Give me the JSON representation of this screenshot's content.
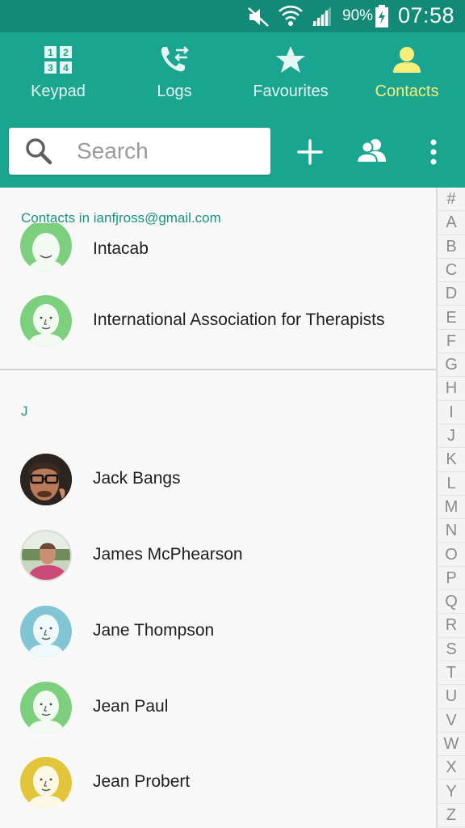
{
  "status_bar": {
    "battery_percent": "90%",
    "time": "07:58",
    "icons": [
      "mute-icon",
      "wifi-icon",
      "signal-icon",
      "battery-charging-icon"
    ]
  },
  "tabs": [
    {
      "label": "Keypad",
      "icon": "keypad-icon",
      "active": false
    },
    {
      "label": "Logs",
      "icon": "call-log-icon",
      "active": false
    },
    {
      "label": "Favourites",
      "icon": "star-icon",
      "active": false
    },
    {
      "label": "Contacts",
      "icon": "contact-person-icon",
      "active": true
    }
  ],
  "toolbar": {
    "search_placeholder": "Search",
    "actions": [
      "add-contact-icon",
      "groups-icon",
      "more-options-icon"
    ]
  },
  "contacts_list": {
    "account_header": "Contacts in ianfjross@gmail.com",
    "partial_contact": "Intacab",
    "contacts_before": [
      {
        "name": "International Association for Therapists",
        "avatar": "default-avatar-green"
      }
    ],
    "section_letter": "J",
    "contacts_j": [
      {
        "name": "Jack Bangs",
        "avatar": "photo-avatar"
      },
      {
        "name": "James McPhearson",
        "avatar": "photo-avatar"
      },
      {
        "name": "Jane Thompson",
        "avatar": "default-avatar-blue"
      },
      {
        "name": "Jean Paul",
        "avatar": "default-avatar-green"
      },
      {
        "name": "Jean Probert",
        "avatar": "default-avatar-yellow"
      }
    ]
  },
  "colors": {
    "accent": "#1aa590",
    "status_bar": "#138a78",
    "active_tab": "#f7ef7a",
    "avatar_green": "#7ccf7c",
    "avatar_blue": "#82c6d6",
    "avatar_yellow": "#e2c53a"
  },
  "index_bar": [
    "#",
    "A",
    "B",
    "C",
    "D",
    "E",
    "F",
    "G",
    "H",
    "I",
    "J",
    "K",
    "L",
    "M",
    "N",
    "O",
    "P",
    "Q",
    "R",
    "S",
    "T",
    "U",
    "V",
    "W",
    "X",
    "Y",
    "Z"
  ]
}
